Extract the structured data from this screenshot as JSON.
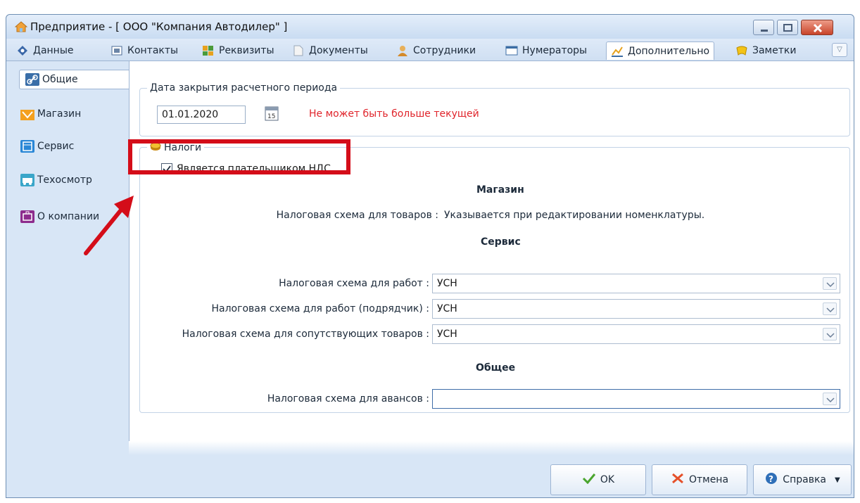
{
  "window": {
    "title": "Предприятие - [ ООО \"Компания Автодилер\" ]"
  },
  "tabs": [
    {
      "label": "Данные",
      "icon": "diamond-icon"
    },
    {
      "label": "Контакты",
      "icon": "contact-card-icon"
    },
    {
      "label": "Реквизиты",
      "icon": "requisites-icon"
    },
    {
      "label": "Документы",
      "icon": "document-icon"
    },
    {
      "label": "Сотрудники",
      "icon": "user-icon"
    },
    {
      "label": "Нумераторы",
      "icon": "counter-icon"
    },
    {
      "label": "Дополнительно",
      "icon": "chart-icon",
      "active": true
    },
    {
      "label": "Заметки",
      "icon": "notes-icon"
    }
  ],
  "sidebar": {
    "items": [
      {
        "label": "Общие",
        "icon": "link-icon",
        "active": true
      },
      {
        "label": "Магазин",
        "icon": "shop-icon"
      },
      {
        "label": "Сервис",
        "icon": "service-icon"
      },
      {
        "label": "Техосмотр",
        "icon": "inspection-icon"
      },
      {
        "label": "О компании",
        "icon": "company-icon"
      }
    ]
  },
  "period": {
    "caption": "Дата закрытия расчетного периода",
    "date_value": "01.01.2020",
    "warning": "Не может быть больше текущей"
  },
  "taxes": {
    "caption": "Налоги",
    "vat_payer_label": "Является плательщиком НДС",
    "vat_payer_checked": true,
    "shop": {
      "title": "Магазин",
      "goods_label": "Налоговая схема для товаров :",
      "goods_value": "Указывается при редактировании номенклатуры."
    },
    "service": {
      "title": "Сервис",
      "works_label": "Налоговая схема для работ :",
      "works_value": "УСН",
      "contractor_label": "Налоговая схема для работ (подрядчик) :",
      "contractor_value": "УСН",
      "related_goods_label": "Налоговая схема для сопутствующих товаров :",
      "related_goods_value": "УСН"
    },
    "general": {
      "title": "Общее",
      "advances_label": "Налоговая схема для авансов :",
      "advances_value": ""
    }
  },
  "buttons": {
    "ok": "OK",
    "cancel": "Отмена",
    "help": "Справка"
  },
  "colors": {
    "annotation": "#d40d19",
    "warning_text": "#e0242b",
    "window_bg": "#d8e6f6"
  }
}
